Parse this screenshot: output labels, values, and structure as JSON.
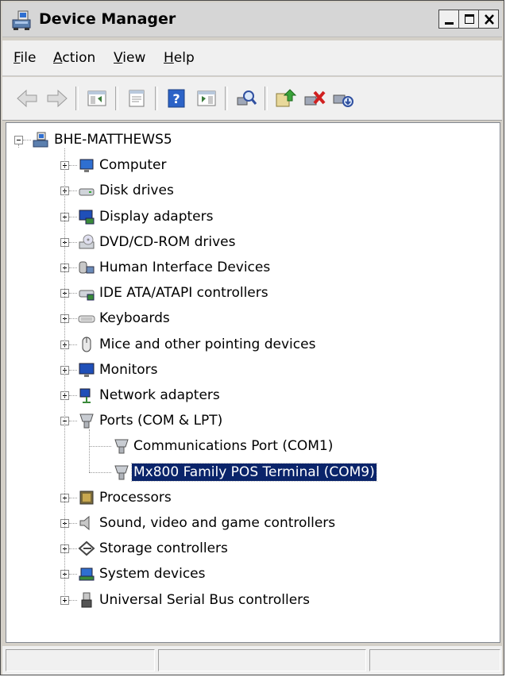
{
  "window": {
    "title": "Device Manager"
  },
  "menu": [
    {
      "label": "File",
      "accel": "F",
      "rest": "ile"
    },
    {
      "label": "Action",
      "accel": "A",
      "rest": "ction"
    },
    {
      "label": "View",
      "accel": "V",
      "rest": "iew"
    },
    {
      "label": "Help",
      "accel": "H",
      "rest": "elp"
    }
  ],
  "toolbar": [
    "back-icon",
    "forward-icon",
    "show-hide-console-tree-icon",
    "properties-icon",
    "help-icon",
    "show-action-pane-icon",
    "scan-hardware-changes-icon",
    "update-driver-icon",
    "uninstall-icon",
    "disable-device-icon"
  ],
  "tree": {
    "root": {
      "label": "BHE-MATTHEWS5",
      "icon": "computer-tree-root-icon"
    },
    "categories": [
      {
        "label": "Computer",
        "icon": "computer-icon",
        "expanded": false
      },
      {
        "label": "Disk drives",
        "icon": "disk-drive-icon",
        "expanded": false
      },
      {
        "label": "Display adapters",
        "icon": "display-adapter-icon",
        "expanded": false
      },
      {
        "label": "DVD/CD-ROM drives",
        "icon": "dvd-drive-icon",
        "expanded": false
      },
      {
        "label": "Human Interface Devices",
        "icon": "hid-icon",
        "expanded": false
      },
      {
        "label": "IDE ATA/ATAPI controllers",
        "icon": "ide-controller-icon",
        "expanded": false
      },
      {
        "label": "Keyboards",
        "icon": "keyboard-icon",
        "expanded": false
      },
      {
        "label": "Mice and other pointing devices",
        "icon": "mouse-icon",
        "expanded": false
      },
      {
        "label": "Monitors",
        "icon": "monitor-icon",
        "expanded": false
      },
      {
        "label": "Network adapters",
        "icon": "network-adapter-icon",
        "expanded": false
      },
      {
        "label": "Ports (COM & LPT)",
        "icon": "port-icon",
        "expanded": true,
        "children": [
          {
            "label": "Communications Port (COM1)",
            "icon": "port-icon",
            "selected": false
          },
          {
            "label": "Mx800 Family POS Terminal (COM9)",
            "icon": "port-icon",
            "selected": true
          }
        ]
      },
      {
        "label": "Processors",
        "icon": "processor-icon",
        "expanded": false
      },
      {
        "label": "Sound, video and game controllers",
        "icon": "speaker-icon",
        "expanded": false
      },
      {
        "label": "Storage controllers",
        "icon": "storage-controller-icon",
        "expanded": false
      },
      {
        "label": "System devices",
        "icon": "system-devices-icon",
        "expanded": false
      },
      {
        "label": "Universal Serial Bus controllers",
        "icon": "usb-icon",
        "expanded": false
      }
    ]
  },
  "colors": {
    "selection": "#0a246a",
    "title_bg": "#d6d6d6",
    "chrome": "#f0f0f0"
  }
}
